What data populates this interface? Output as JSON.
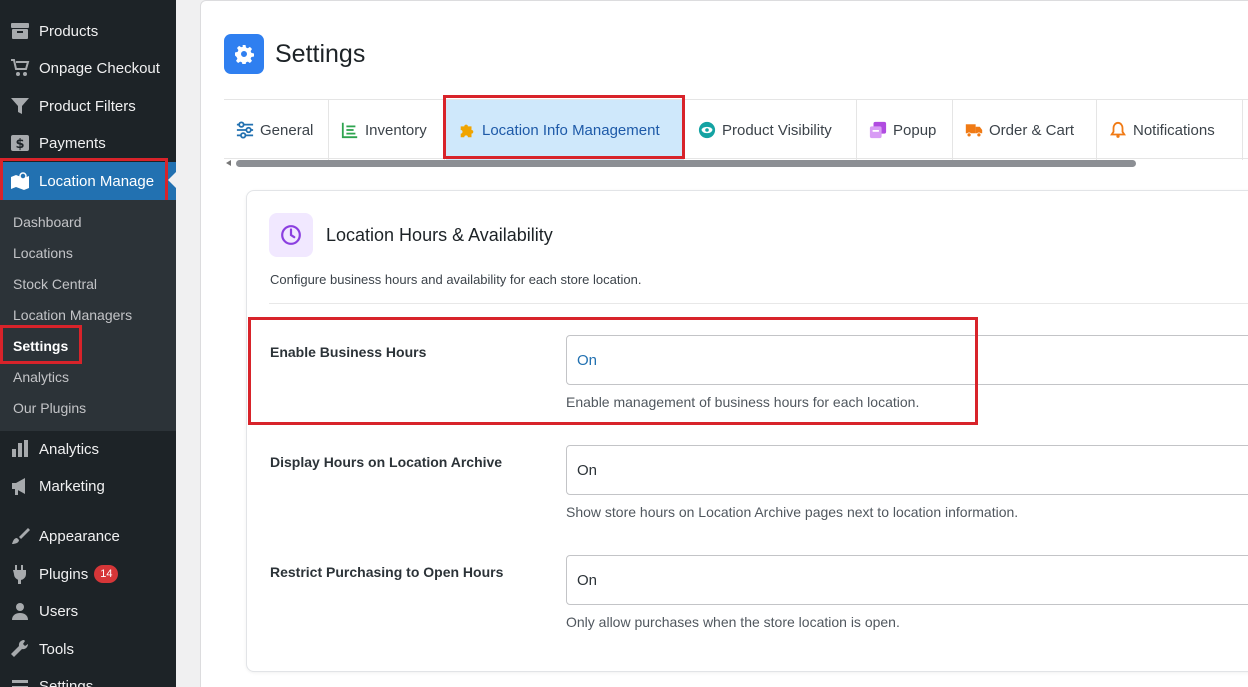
{
  "sidebar": {
    "top_items": [
      {
        "label": "Products",
        "icon": "archive-icon"
      },
      {
        "label": "Onpage Checkout",
        "icon": "cart-icon"
      },
      {
        "label": "Product Filters",
        "icon": "filter-icon"
      },
      {
        "label": "Payments",
        "icon": "dollar-icon"
      }
    ],
    "active_item": {
      "label": "Location Manage",
      "icon": "map-icon"
    },
    "submenu": [
      {
        "label": "Dashboard"
      },
      {
        "label": "Locations"
      },
      {
        "label": "Stock Central"
      },
      {
        "label": "Location Managers"
      },
      {
        "label": "Settings"
      },
      {
        "label": "Analytics"
      },
      {
        "label": "Our Plugins"
      }
    ],
    "bottom_items": [
      {
        "label": "Analytics",
        "icon": "bar-chart-icon"
      },
      {
        "label": "Marketing",
        "icon": "megaphone-icon"
      },
      {
        "label": "Appearance",
        "icon": "paintbrush-icon"
      },
      {
        "label": "Plugins",
        "icon": "plug-icon",
        "badge": "14"
      },
      {
        "label": "Users",
        "icon": "user-icon"
      },
      {
        "label": "Tools",
        "icon": "wrench-icon"
      },
      {
        "label": "Settings",
        "icon": "settings-icon"
      }
    ]
  },
  "header": {
    "title": "Settings"
  },
  "tabs": [
    {
      "label": "General",
      "icon": "sliders-icon"
    },
    {
      "label": "Inventory",
      "icon": "list-icon"
    },
    {
      "label": "Location Info Management",
      "icon": "puzzle-icon"
    },
    {
      "label": "Product Visibility",
      "icon": "eye-icon"
    },
    {
      "label": "Popup",
      "icon": "popup-icon"
    },
    {
      "label": "Order & Cart",
      "icon": "truck-icon"
    },
    {
      "label": "Notifications",
      "icon": "bell-icon"
    }
  ],
  "card": {
    "title": "Location Hours & Availability",
    "description": "Configure business hours and availability for each store location.",
    "fields": [
      {
        "label": "Enable Business Hours",
        "value": "On",
        "help": "Enable management of business hours for each location."
      },
      {
        "label": "Display Hours on Location Archive",
        "value": "On",
        "help": "Show store hours on Location Archive pages next to location information."
      },
      {
        "label": "Restrict Purchasing to Open Hours",
        "value": "On",
        "help": "Only allow purchases when the store location is open."
      }
    ]
  },
  "colors": {
    "sidebar_bg": "#1d2327",
    "accent": "#2271b1",
    "highlight_box": "#d8232a",
    "active_tab_bg": "#cfe8fb"
  }
}
